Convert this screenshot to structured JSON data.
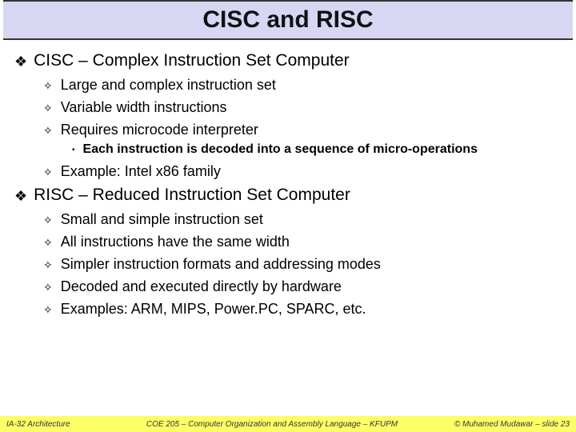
{
  "title": "CISC and RISC",
  "bullets": [
    {
      "level": 1,
      "text": "CISC – Complex Instruction Set Computer"
    },
    {
      "level": 2,
      "text": "Large and complex instruction set"
    },
    {
      "level": 2,
      "text": "Variable width instructions"
    },
    {
      "level": 2,
      "text": "Requires microcode interpreter"
    },
    {
      "level": 3,
      "text": "Each instruction is decoded into a sequence of micro-operations"
    },
    {
      "level": 2,
      "text": "Example: Intel x86 family"
    },
    {
      "level": 1,
      "text": "RISC – Reduced Instruction Set Computer"
    },
    {
      "level": 2,
      "text": "Small and simple instruction set"
    },
    {
      "level": 2,
      "text": "All instructions have the same width"
    },
    {
      "level": 2,
      "text": "Simpler instruction formats and addressing modes"
    },
    {
      "level": 2,
      "text": "Decoded and executed directly by hardware"
    },
    {
      "level": 2,
      "text": "Examples: ARM, MIPS, Power.PC, SPARC, etc."
    }
  ],
  "footer": {
    "left": "IA-32 Architecture",
    "center": "COE 205 – Computer Organization and Assembly Language – KFUPM",
    "right": "© Muhamed Mudawar – slide 23"
  },
  "glyphs": {
    "l1": "❖",
    "l2": "✧",
    "l3": "▪"
  }
}
